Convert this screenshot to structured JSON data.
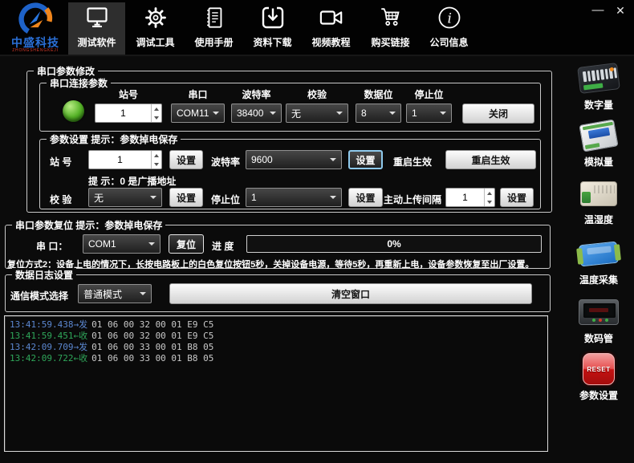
{
  "window": {
    "minimize": "—",
    "close": "✕"
  },
  "logo": {
    "title": "中盛科技",
    "subtitle": "ZHONGSHENGKEJI"
  },
  "toolbar": {
    "items": [
      {
        "label": "测试软件",
        "icon": "monitor",
        "active": true
      },
      {
        "label": "调试工具",
        "icon": "gear",
        "active": false
      },
      {
        "label": "使用手册",
        "icon": "manual",
        "active": false
      },
      {
        "label": "资料下载",
        "icon": "download",
        "active": false
      },
      {
        "label": "视频教程",
        "icon": "video-camera",
        "active": false
      },
      {
        "label": "购买链接",
        "icon": "shopping-cart",
        "active": false
      },
      {
        "label": "公司信息",
        "icon": "info",
        "active": false
      }
    ]
  },
  "serial_modify": {
    "title": "串口参数修改",
    "connection": {
      "title": "串口连接参数",
      "led_status": "connected",
      "station_label": "站号",
      "station_value": "1",
      "port_label": "串口",
      "port_value": "COM11",
      "baud_label": "波特率",
      "baud_value": "38400",
      "parity_label": "校验",
      "parity_value": "无",
      "databits_label": "数据位",
      "databits_value": "8",
      "stopbits_label": "停止位",
      "stopbits_value": "1",
      "close_button": "关闭"
    },
    "settings": {
      "title": "参数设置 提示：参数掉电保存",
      "station_label": "站 号",
      "station_value": "1",
      "set_button": "设置",
      "baud_label": "波特率",
      "baud_value": "9600",
      "restart_label": "重启生效",
      "restart_button": "重启生效",
      "hint": "提 示：0 是广播地址",
      "parity_label": "校 验",
      "parity_value": "无",
      "stopbits_label": "停止位",
      "stopbits_value": "1",
      "upload_label": "主动上传间隔",
      "upload_value": "1"
    }
  },
  "serial_reset": {
    "title": "串口参数复位 提示：参数掉电保存",
    "port_label": "串 口：",
    "port_value": "COM1",
    "reset_button": "复位",
    "progress_label": "进 度",
    "progress_value": "0%",
    "note": "复位方式2：设备上电的情况下，长按电路板上的白色复位按钮5秒，关掉设备电源，等待5秒，再重新上电，设备参数恢复至出厂设置。"
  },
  "log_settings": {
    "title": "数据日志设置",
    "mode_label": "通信模式选择",
    "mode_value": "普通模式",
    "clear_button": "清空窗口"
  },
  "log": {
    "lines": [
      {
        "time": "13:41:59.438→发",
        "data": "01 06 00 32 00 01 E9 C5",
        "direction": "send"
      },
      {
        "time": "13:41:59.451←收",
        "data": "01 06 00 32 00 01 E9 C5",
        "direction": "receive"
      },
      {
        "time": "13:42:09.709→发",
        "data": "01 06 00 33 00 01 B8 05",
        "direction": "send"
      },
      {
        "time": "13:42:09.722←收",
        "data": "01 06 00 33 00 01 B8 05",
        "direction": "receive"
      }
    ]
  },
  "sidebar": {
    "items": [
      {
        "label": "数字量",
        "icon": "relay-module"
      },
      {
        "label": "模拟量",
        "icon": "analog-module"
      },
      {
        "label": "温湿度",
        "icon": "temp-humidity-module"
      },
      {
        "label": "温度采集",
        "icon": "temp-collector-module"
      },
      {
        "label": "数码管",
        "icon": "digital-display-module"
      },
      {
        "label": "参数设置",
        "icon": "reset-button",
        "icon_text": "RESET"
      }
    ]
  },
  "colors": {
    "accent_focus": "#8ec9ec",
    "led_green": "#55b227",
    "log_send": "#5b87d0",
    "log_receive": "#2fa65a",
    "reset_red": "#c31212",
    "logo_blue": "#2a6fd6",
    "logo_orange": "#f0861c"
  }
}
